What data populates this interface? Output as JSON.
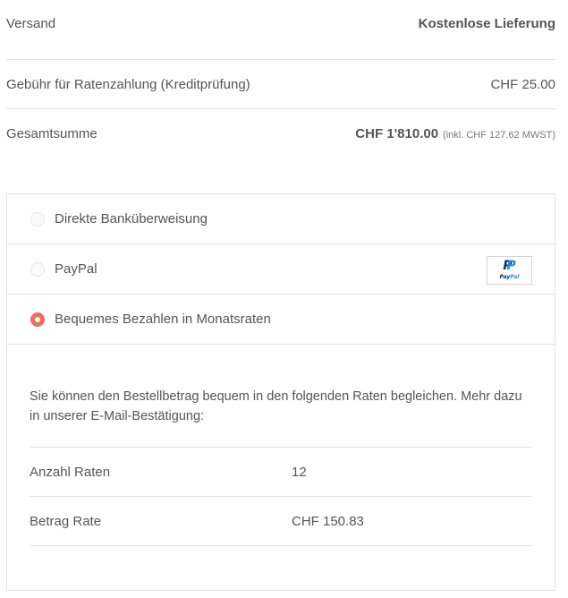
{
  "summary": {
    "shipping_label": "Versand",
    "shipping_value": "Kostenlose Lieferung",
    "fee_label": "Gebühr für Ratenzahlung (Kreditprüfung)",
    "fee_value": "CHF 25.00",
    "total_label": "Gesamtsumme",
    "total_value": "CHF 1'810.00",
    "total_tax": "(inkl. CHF 127.62 MWST)"
  },
  "payment": {
    "options": [
      {
        "label": "Direkte Banküberweisung",
        "selected": false
      },
      {
        "label": "PayPal",
        "selected": false,
        "logo": "paypal-logo"
      },
      {
        "label": "Bequemes Bezahlen in Monatsraten",
        "selected": true
      }
    ],
    "paypal_logo_text": "PayPal",
    "accent_color": "#ec6d5a"
  },
  "installments": {
    "description": "Sie können den Bestellbetrag bequem in den folgenden Raten begleichen. Mehr dazu in unserer E-Mail-Bestätigung:",
    "rows": [
      {
        "label": "Anzahl Raten",
        "value": "12"
      },
      {
        "label": "Betrag Rate",
        "value": "CHF 150.83"
      }
    ]
  }
}
